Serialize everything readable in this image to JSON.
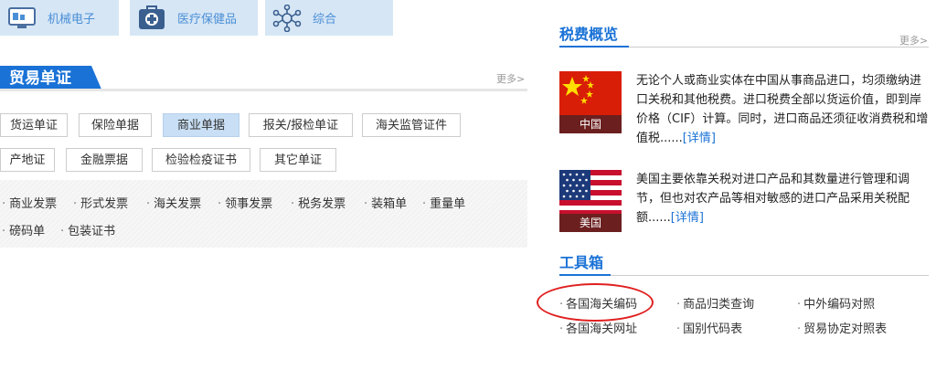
{
  "categories": [
    {
      "label": "机械电子",
      "icon": "monitor-icon"
    },
    {
      "label": "医疗保健品",
      "icon": "medical-kit-icon"
    },
    {
      "label": "综合",
      "icon": "network-icon"
    }
  ],
  "trade": {
    "title": "贸易单证",
    "more": "更多>",
    "tabs_row1": [
      "货运单证",
      "保险单据",
      "商业单据",
      "报关/报检单证",
      "海关监管证件"
    ],
    "tabs_row2": [
      "产地证",
      "金融票据",
      "检验检疫证书",
      "其它单证"
    ],
    "active_tab": "商业单据",
    "sub_row1": [
      "商业发票",
      "形式发票",
      "海关发票",
      "领事发票",
      "税务发票",
      "装箱单",
      "重量单"
    ],
    "sub_row2": [
      "磅码单",
      "包装证书"
    ]
  },
  "tax": {
    "title": "税费概览",
    "more": "更多>",
    "items": [
      {
        "country": "中国",
        "text": "无论个人或商业实体在中国从事商品进口，均须缴纳进口关税和其他税费。进口税费全部以货运价值，即到岸价格（CIF）计算。同时，进口商品还须征收消费税和增值税......",
        "link": "[详情]"
      },
      {
        "country": "美国",
        "text": "美国主要依靠关税对进口产品和其数量进行管理和调节，但也对农产品等相对敏感的进口产品采用关税配额......",
        "link": "[详情]"
      }
    ]
  },
  "toolbox": {
    "title": "工具箱",
    "row1": [
      "各国海关编码",
      "商品归类查询",
      "中外编码对照"
    ],
    "row2": [
      "各国海关网址",
      "国别代码表",
      "贸易协定对照表"
    ]
  },
  "colors": {
    "accent": "#1a72d6",
    "tile": "#d6e6f5",
    "highlight": "#e02020"
  }
}
